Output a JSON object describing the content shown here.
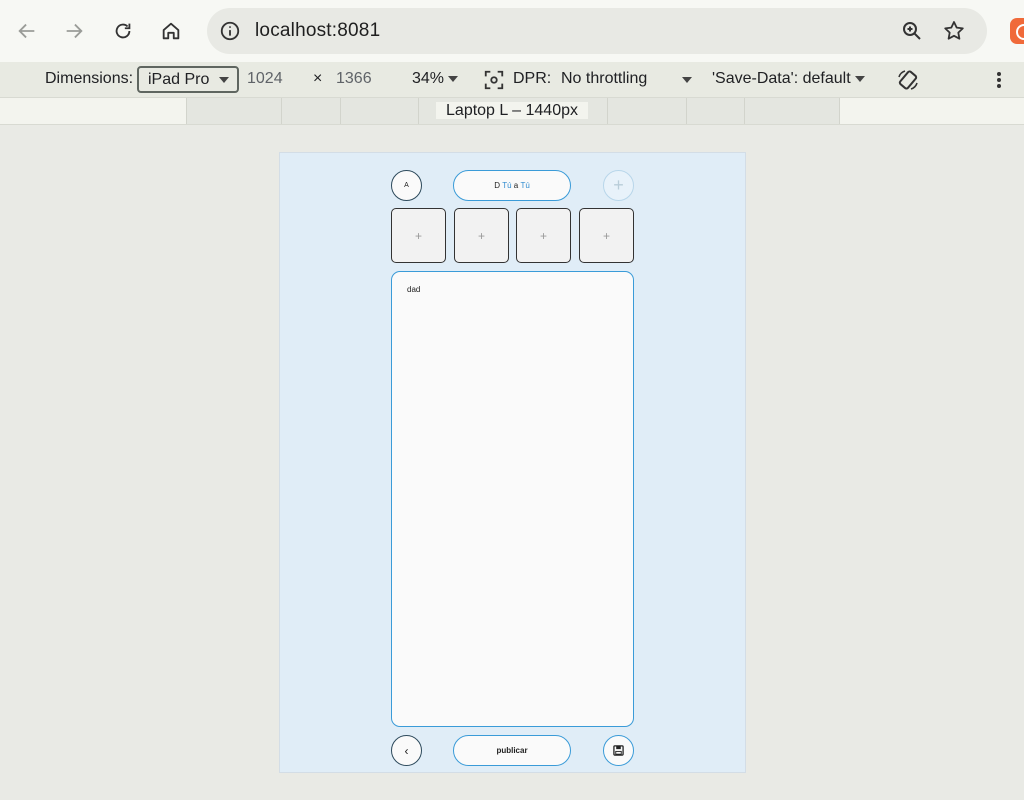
{
  "browser": {
    "url": "localhost:8081",
    "icons": {
      "back": "arrow-left-icon",
      "forward": "arrow-right-icon",
      "reload": "reload-icon",
      "home": "home-icon",
      "info": "info-icon",
      "zoom": "zoom-icon",
      "bookmark": "star-icon",
      "extension": "extension-icon"
    }
  },
  "device_toolbar": {
    "dimensions_label": "Dimensions:",
    "device": "iPad Pro",
    "width": "1024",
    "times": "×",
    "height": "1366",
    "zoom": "34%",
    "dpr_label": "DPR:",
    "throttling": "No throttling",
    "save_data": "'Save-Data': default"
  },
  "ruler": {
    "label": "Laptop L – 1440px"
  },
  "app": {
    "avatar_letter": "A",
    "title_prefix": "D",
    "title_from": "Tú",
    "title_sep": "a",
    "title_to": "Tú",
    "add_symbol": "+",
    "tiles": [
      "+",
      "+",
      "+",
      "+"
    ],
    "editor_text": "dad",
    "back_symbol": "‹",
    "publish_label": "publicar"
  },
  "colors": {
    "accent": "#3a9bd8",
    "device_bg": "#e0edf7",
    "extension": "#f06a3a"
  }
}
